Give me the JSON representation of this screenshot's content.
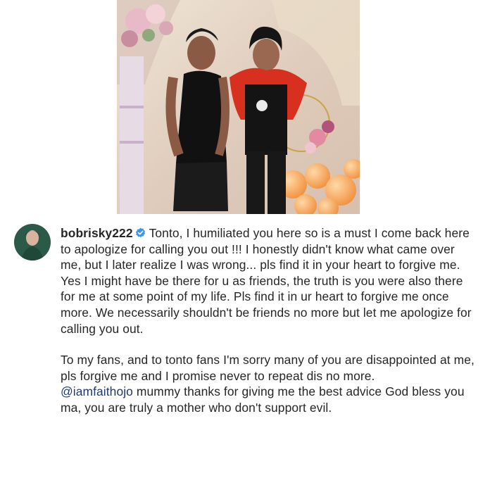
{
  "post": {
    "username": "bobrisky222",
    "comment_paragraph_1": "Tonto, I humiliated you here so is a must I come back here to apologize for calling you out !!! I honestly didn't know what came over me, but I later realize I was wrong... pls find it in your heart to forgive me. Yes I might have be there for u as friends, the truth is you were also there for me at some point of my life. Pls find it in ur heart to forgive me once more. We necessarily shouldn't be friends no more but let me apologize for calling you out.",
    "comment_paragraph_2": "To my fans, and to tonto fans I'm sorry many of you are disappointed at me, pls forgive me and I promise never to repeat dis no more.",
    "mention": "@iamfaithojo",
    "comment_paragraph_3_rest": " mummy thanks for giving me the best advice God bless you ma, you are truly a mother who don't support evil."
  },
  "colors": {
    "verified_badge": "#3897f0",
    "mention": "#1e3a6e",
    "text": "#262626"
  }
}
